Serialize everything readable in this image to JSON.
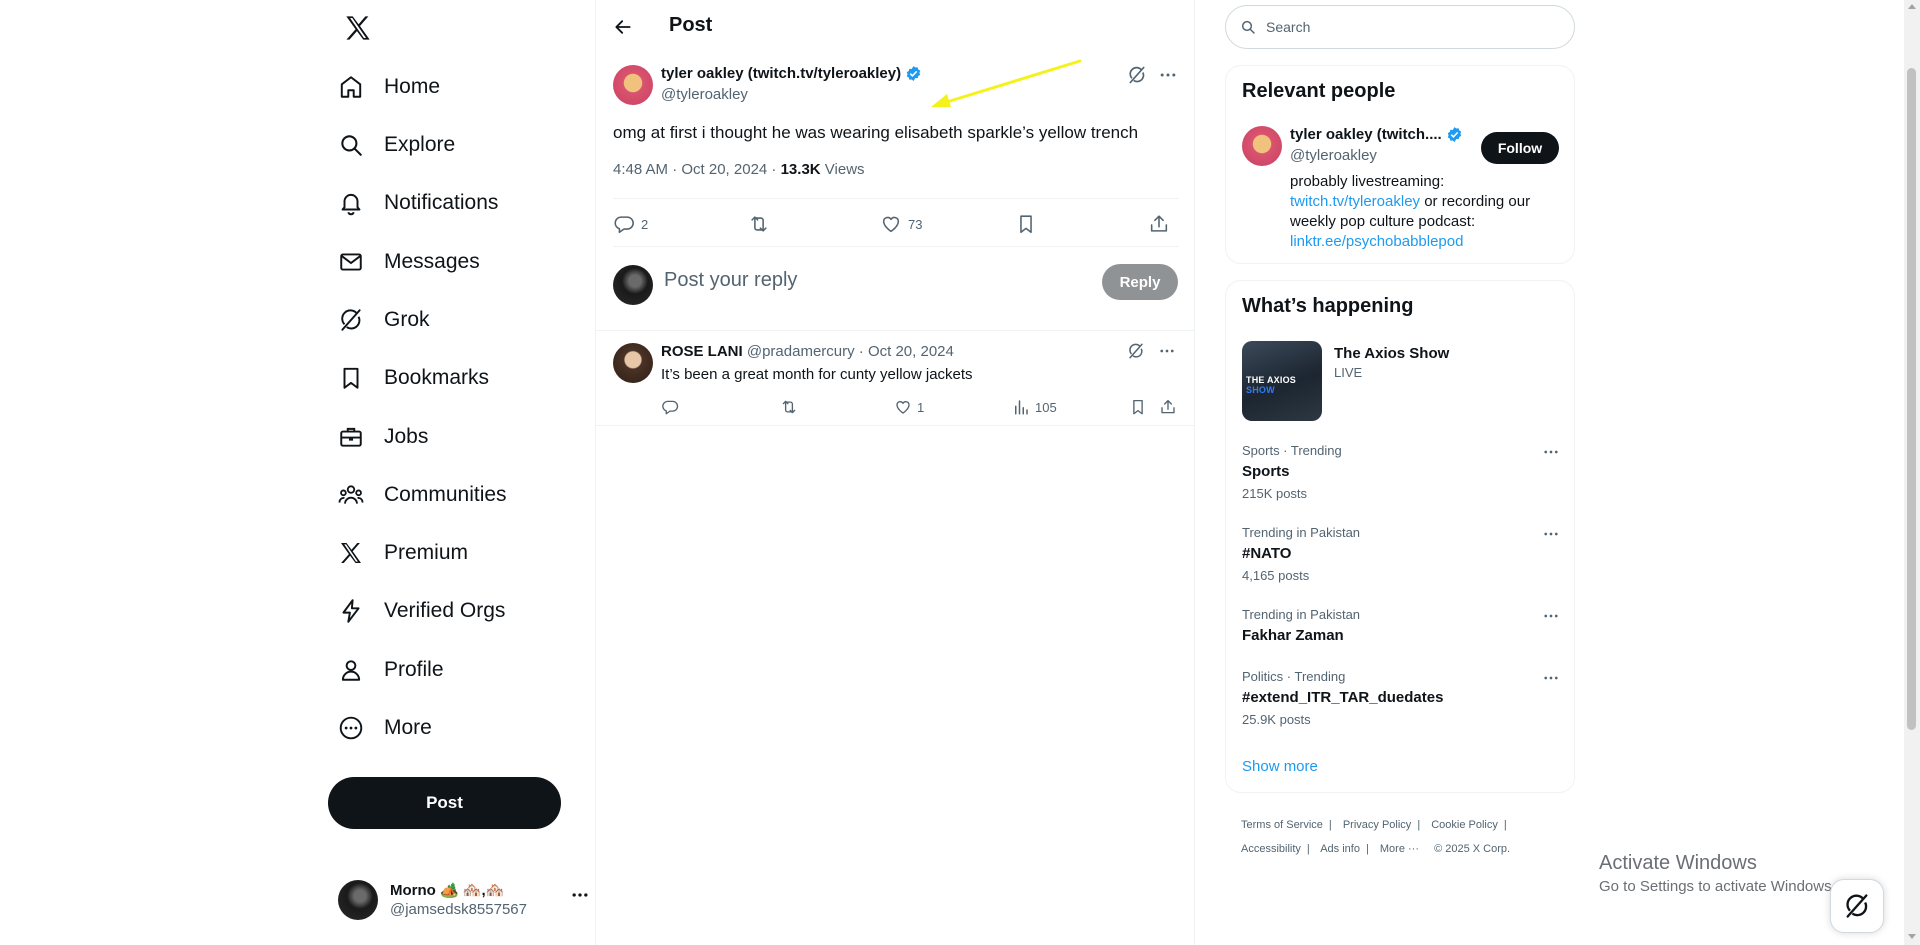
{
  "sidebar": {
    "logo": "X",
    "nav": [
      {
        "label": "Home",
        "icon": "home-icon"
      },
      {
        "label": "Explore",
        "icon": "search-icon"
      },
      {
        "label": "Notifications",
        "icon": "bell-icon"
      },
      {
        "label": "Messages",
        "icon": "envelope-icon"
      },
      {
        "label": "Grok",
        "icon": "grok-icon"
      },
      {
        "label": "Bookmarks",
        "icon": "bookmark-icon"
      },
      {
        "label": "Jobs",
        "icon": "briefcase-icon"
      },
      {
        "label": "Communities",
        "icon": "people-icon"
      },
      {
        "label": "Premium",
        "icon": "x-logo-icon"
      },
      {
        "label": "Verified Orgs",
        "icon": "lightning-icon"
      },
      {
        "label": "Profile",
        "icon": "person-icon"
      },
      {
        "label": "More",
        "icon": "more-circle-icon"
      }
    ],
    "post_button": "Post",
    "account": {
      "name": "Morno 🏕️ 🏘️,🏘️",
      "handle": "@jamsedsk8557567"
    }
  },
  "header": {
    "title": "Post"
  },
  "main_post": {
    "author_name": "tyler oakley (twitch.tv/tyleroakley)",
    "author_handle": "@tyleroakley",
    "text": "omg at first i thought he was wearing elisabeth sparkle’s yellow trench",
    "time": "4:48 AM · Oct 20, 2024 · ",
    "views_count": "13.3K",
    "views_label": " Views",
    "stats": {
      "replies": "2",
      "likes": "73"
    }
  },
  "reply_box": {
    "placeholder": "Post your reply",
    "button": "Reply"
  },
  "replies": [
    {
      "name": "ROSE LANI",
      "handle": "@pradamercury",
      "date": "· Oct 20, 2024",
      "text": "It’s been a great month for cunty yellow jackets",
      "stats": {
        "likes": "1",
        "views": "105"
      }
    }
  ],
  "search": {
    "placeholder": "Search"
  },
  "relevant_people": {
    "title": "Relevant people",
    "name": "tyler oakley (twitch....",
    "handle": "@tyleroakley",
    "follow": "Follow",
    "bio_1": "probably livestreaming: ",
    "bio_link_1": "twitch.tv/tyleroakley",
    "bio_2": " or recording our weekly pop culture podcast: ",
    "bio_link_2": "linktr.ee/psychobabblepod"
  },
  "happening": {
    "title": "What’s happening",
    "feature": {
      "title": "The Axios Show",
      "status": "LIVE",
      "thumb_text_1": "THE AXIOS ",
      "thumb_text_2": "SHOW"
    },
    "trends": [
      {
        "context": "Sports · Trending",
        "name": "Sports",
        "count": "215K posts"
      },
      {
        "context": "Trending in Pakistan",
        "name": "#NATO",
        "count": "4,165 posts"
      },
      {
        "context": "Trending in Pakistan",
        "name": "Fakhar Zaman",
        "count": ""
      },
      {
        "context": "Politics · Trending",
        "name": "#extend_ITR_TAR_duedates",
        "count": "25.9K posts"
      }
    ],
    "show_more": "Show more"
  },
  "footer": {
    "terms": "Terms of Service",
    "privacy": "Privacy Policy",
    "cookie": "Cookie Policy",
    "accessibility": "Accessibility",
    "ads": "Ads info",
    "more": "More ···",
    "copyright": "© 2025 X Corp."
  },
  "os_overlay": {
    "line1": "Activate Windows",
    "line2": "Go to Settings to activate Windows."
  },
  "colors": {
    "accent": "#1d9bf0",
    "text": "#0f1419",
    "muted": "#536471",
    "annotation_arrow": "#f5f21b"
  }
}
